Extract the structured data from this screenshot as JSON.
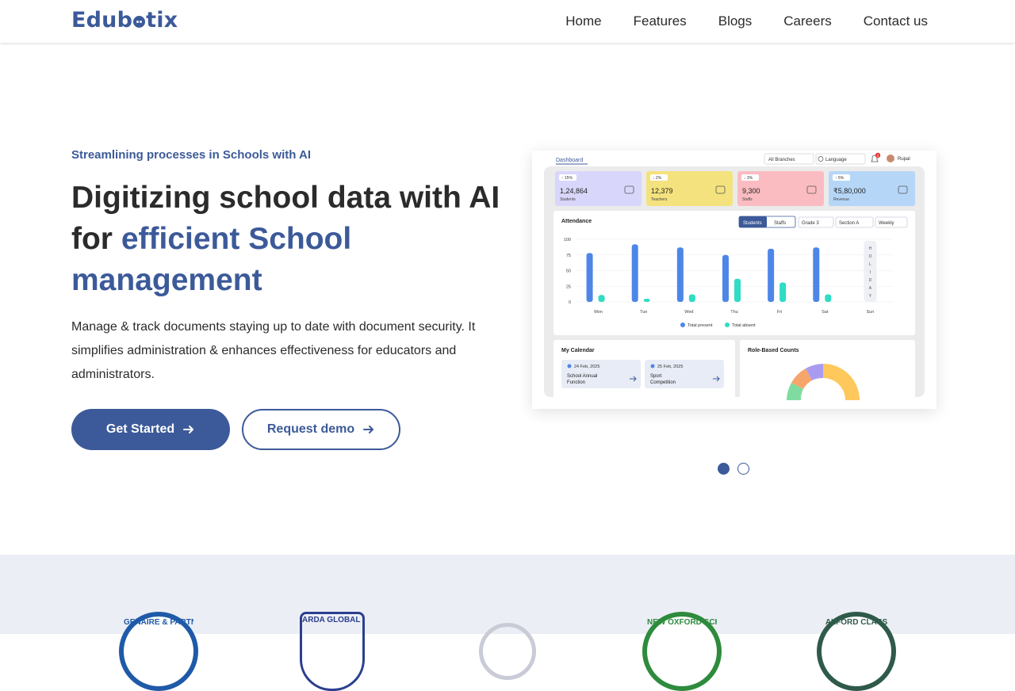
{
  "brand": {
    "name": "Edubotix",
    "color": "#3c5a99"
  },
  "nav": {
    "items": [
      "Home",
      "Features",
      "Blogs",
      "Careers",
      "Contact us"
    ]
  },
  "hero": {
    "tagline": "Streamlining processes in Schools with AI",
    "title_part1": "Digitizing school data with AI for ",
    "title_accent": "efficient School management",
    "description": "Manage & track documents staying up to date with document security. It simplifies administration & enhances effectiveness for educators and administrators.",
    "primary_button": "Get Started",
    "secondary_button": "Request demo"
  },
  "dashboard": {
    "title": "Dashboard",
    "branch": "All Branches",
    "language": "Language",
    "notification_count": "2",
    "user": "Rupal",
    "stats": [
      {
        "change": "↑ 15%",
        "value": "1,24,864",
        "label": "Students",
        "color": "#d9d6fb"
      },
      {
        "change": "↓ 2%",
        "value": "12,379",
        "label": "Teachers",
        "color": "#f4e27e"
      },
      {
        "change": "↓ 3%",
        "value": "9,300",
        "label": "Staffs",
        "color": "#fbbcc1"
      },
      {
        "change": "↑ 5%",
        "value": "₹5,80,000",
        "label": "Revenue",
        "color": "#b6d6f8"
      }
    ],
    "attendance": {
      "title": "Attendance",
      "toggle": [
        "Students",
        "Staffs"
      ],
      "filters": [
        "Grade 3",
        "Section A",
        "Weekly"
      ],
      "holiday_label": "HOLIDAY",
      "legend": [
        "Total present",
        "Total absent"
      ]
    },
    "calendar": {
      "title": "My Calendar",
      "events": [
        {
          "date": "24 Feb, 2025",
          "name": "School Annual Function"
        },
        {
          "date": "25 Feb, 2025",
          "name": "Sport Competition"
        }
      ]
    },
    "role_counts": {
      "title": "Role-Based Counts"
    }
  },
  "chart_data": {
    "type": "bar",
    "categories": [
      "Mon",
      "Tue",
      "Wed",
      "Thu",
      "Fri",
      "Sat",
      "Sun"
    ],
    "series": [
      {
        "name": "Total present",
        "values": [
          78,
          92,
          87,
          75,
          85,
          87,
          null
        ],
        "color": "#4e86e8"
      },
      {
        "name": "Total absent",
        "values": [
          11,
          5,
          12,
          37,
          31,
          12,
          null
        ],
        "color": "#2fdcc4"
      }
    ],
    "yticks": [
      100,
      75,
      50,
      25,
      0
    ],
    "ylim": [
      0,
      100
    ]
  },
  "carousel": {
    "count": 2,
    "active": 0
  },
  "partners": [
    {
      "text": "GENAIRE & PARTNERS",
      "color": "#1f5aa8"
    },
    {
      "text": "ARDA GLOBAL SCHOOL",
      "color": "#2a3f8f"
    },
    {
      "text": "",
      "color": "#c9ccd6"
    },
    {
      "text": "NEW OXFORD SCHOOL",
      "color": "#2e8b3d"
    },
    {
      "text": "ALFORD CLASS",
      "color": "#2f5a4a"
    }
  ]
}
